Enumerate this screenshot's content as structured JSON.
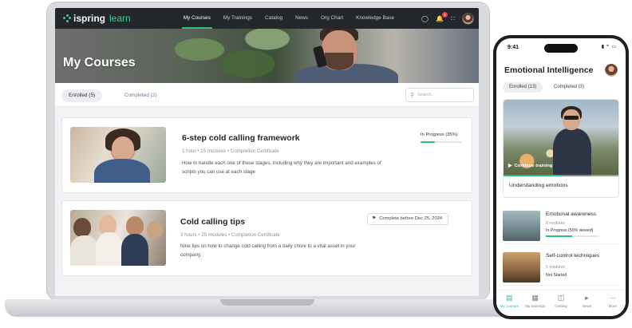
{
  "nav": {
    "logo_main": "ispring",
    "logo_accent": "learn",
    "links": [
      {
        "label": "My Courses",
        "active": true
      },
      {
        "label": "My Trainings",
        "active": false
      },
      {
        "label": "Catalog",
        "active": false
      },
      {
        "label": "News",
        "active": false
      },
      {
        "label": "Org Chart",
        "active": false
      },
      {
        "label": "Knowledge Base",
        "active": false
      }
    ],
    "notification_count": "4"
  },
  "hero": {
    "title": "My Courses"
  },
  "tabs": {
    "enrolled": "Enrolled (5)",
    "completed": "Completed (2)"
  },
  "search": {
    "placeholder": "Search..."
  },
  "courses": [
    {
      "title": "6-step cold calling framework",
      "duration": "1 hour",
      "modules": "15 modules",
      "certificate": "Completion Certificate",
      "description": "How to handle each one of these stages, including why they are important and examples of scripts you can use at each stage",
      "status": "In Progress (35%)",
      "progress": 0.35
    },
    {
      "title": "Cold calling tips",
      "duration": "3 hours",
      "modules": "25 modules",
      "certificate": "Completion Certificate",
      "description": "Nine tips on how to change cold calling from a daily chore to a vital asset in your company.",
      "deadline": "Complete before Dec 25, 2024"
    }
  ],
  "phone": {
    "time": "9:41",
    "title": "Emotional Intelligence",
    "tabs": {
      "enrolled": "Enrolled (13)",
      "completed": "Completed (3)"
    },
    "featured": {
      "continue_label": "Continue training",
      "title": "Understanding emotions",
      "progress": 0.5
    },
    "items": [
      {
        "title": "Emotional awareness",
        "modules": "8 modules",
        "status": "In Progress (50% viewed)",
        "progress": 0.5
      },
      {
        "title": "Self-control techniques",
        "modules": "5 modules",
        "status": "Not Started"
      }
    ],
    "bottom_nav": [
      {
        "label": "My courses",
        "icon": "book-icon",
        "active": true
      },
      {
        "label": "My trainings",
        "icon": "calendar-icon",
        "active": false
      },
      {
        "label": "Catalog",
        "icon": "library-icon",
        "active": false
      },
      {
        "label": "News",
        "icon": "megaphone-icon",
        "active": false
      },
      {
        "label": "More",
        "icon": "more-icon",
        "active": false
      }
    ]
  },
  "colors": {
    "accent": "#2fbf7a",
    "nav_bg": "#23262b",
    "badge": "#e8453c"
  }
}
